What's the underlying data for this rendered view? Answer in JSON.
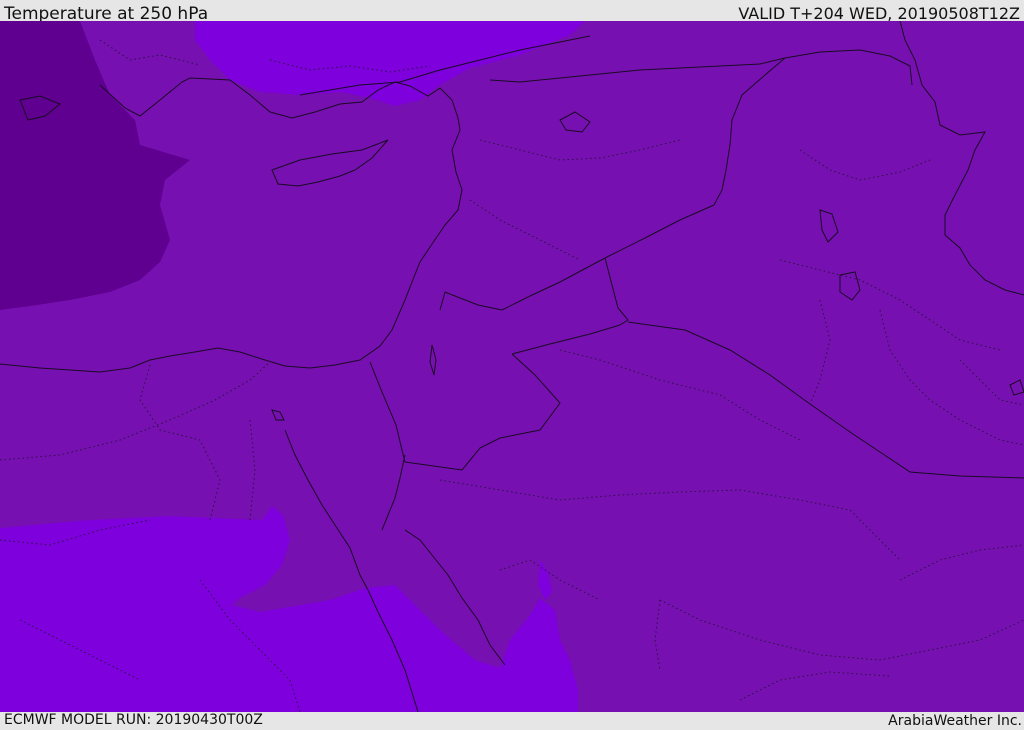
{
  "header": {
    "title": "Temperature at 250 hPa",
    "valid": "VALID T+204 WED, 20190508T12Z"
  },
  "footer": {
    "model_run": "ECMWF MODEL RUN: 20190430T00Z",
    "credit": "ArabiaWeather Inc."
  },
  "map": {
    "colors": {
      "base_band": "#7710b0",
      "cold_band": "#5f0090",
      "warm_band": "#7e00dc",
      "lines": "#1a0a25"
    }
  }
}
